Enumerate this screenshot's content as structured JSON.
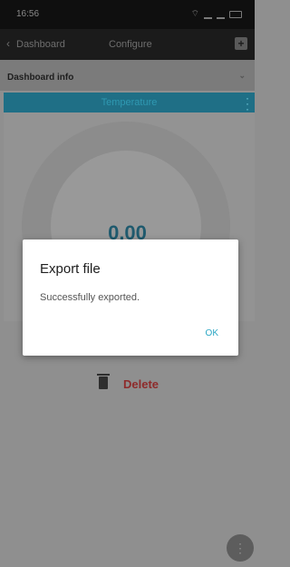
{
  "status_bar": {
    "time": "16:56"
  },
  "app_bar": {
    "back_label": "Dashboard",
    "title": "Configure"
  },
  "info_bar": {
    "label": "Dashboard info"
  },
  "widget": {
    "title": "Temperature",
    "value": "0.00"
  },
  "delete": {
    "label": "Delete"
  },
  "dialog": {
    "title": "Export file",
    "message": "Successfully exported.",
    "ok_label": "OK"
  },
  "icons": [
    "back-arrow-icon",
    "add-icon",
    "chevron-down-icon",
    "more-vert-icon",
    "trash-icon"
  ],
  "colors": {
    "accent": "#2aa6c4",
    "delete": "#8e2b2b",
    "header_bar": "#1f6f86"
  }
}
